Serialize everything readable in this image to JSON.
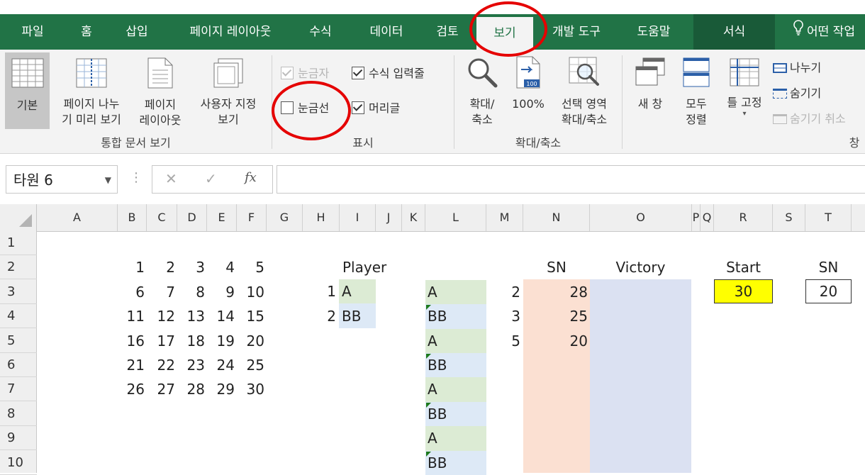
{
  "ribbon_tabs": [
    "파일",
    "홈",
    "삽입",
    "페이지 레이아웃",
    "수식",
    "데이터",
    "검토",
    "보기",
    "개발 도구",
    "도움말",
    "서식"
  ],
  "tell_me": "어떤 작업",
  "workbook_views": {
    "normal": "기본",
    "page_break": "페이지 나누\n기 미리 보기",
    "page_layout": "페이지\n레이아웃",
    "custom": "사용자 지정\n보기",
    "label": "통합 문서 보기"
  },
  "show": {
    "ruler": "눈금자",
    "formula_bar": "수식 입력줄",
    "gridlines": "눈금선",
    "headings": "머리글",
    "label": "표시"
  },
  "zoom": {
    "zoom": "확대/\n축소",
    "hundred": "100%",
    "to_selection": "선택 영역\n확대/축소",
    "label": "확대/축소"
  },
  "window": {
    "new_window": "새 창",
    "arrange_all": "모두\n정렬",
    "freeze": "틀 고정",
    "split": "나누기",
    "hide": "숨기기",
    "unhide": "숨기기 취소",
    "label": "창"
  },
  "formula_bar": {
    "name_box": "타원 6",
    "fx": "fx",
    "value": ""
  },
  "columns": [
    "A",
    "B",
    "C",
    "D",
    "E",
    "F",
    "G",
    "H",
    "I",
    "J",
    "K",
    "L",
    "M",
    "N",
    "O",
    "P",
    "Q",
    "R",
    "S",
    "T"
  ],
  "rows": [
    "1",
    "2",
    "3",
    "4",
    "5",
    "6",
    "7",
    "8",
    "9",
    "10"
  ],
  "grid_numbers": [
    [
      "1",
      "2",
      "3",
      "4",
      "5"
    ],
    [
      "6",
      "7",
      "8",
      "9",
      "10"
    ],
    [
      "11",
      "12",
      "13",
      "14",
      "15"
    ],
    [
      "16",
      "17",
      "18",
      "19",
      "20"
    ],
    [
      "21",
      "22",
      "23",
      "24",
      "25"
    ],
    [
      "26",
      "27",
      "28",
      "29",
      "30"
    ]
  ],
  "headers": {
    "player": "Player",
    "sn": "SN",
    "victory": "Victory",
    "start": "Start",
    "sn2": "SN"
  },
  "players": [
    {
      "index": "1",
      "name": "A"
    },
    {
      "index": "2",
      "name": "BB"
    }
  ],
  "l_column": [
    "A",
    "BB",
    "A",
    "BB",
    "A",
    "BB",
    "A",
    "BB"
  ],
  "m_values": [
    "2",
    "3",
    "5"
  ],
  "n_values": [
    "28",
    "25",
    "20"
  ],
  "start_value": "30",
  "sn_value": "20",
  "colors": {
    "ribbon_green": "#217346",
    "player_fill": "#dcebd4",
    "bb_fill": "#dde9f6",
    "sn_fill": "#fbe0d2",
    "victory_fill": "#dbe1f2",
    "start_fill": "#ffff00",
    "annotation": "#e50000"
  }
}
